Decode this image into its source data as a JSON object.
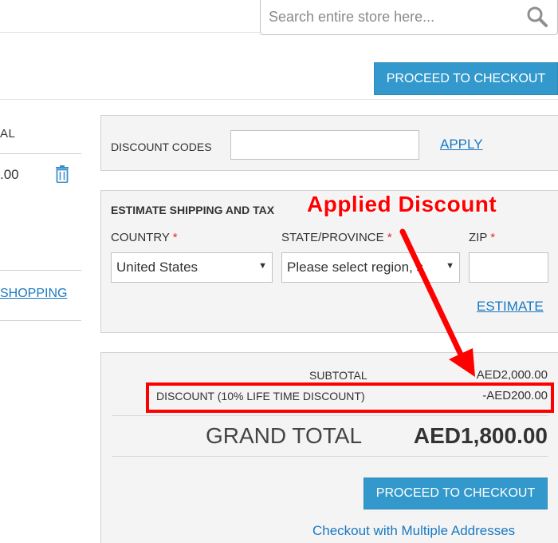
{
  "search": {
    "placeholder": "Search entire store here..."
  },
  "buttons": {
    "proceed_top": "PROCEED TO CHECKOUT",
    "proceed_bottom": "PROCEED TO CHECKOUT"
  },
  "cart": {
    "column_header_fragment": "AL",
    "item_subtotal_fragment": ".00",
    "continue_shopping_fragment": "SHOPPING"
  },
  "discount": {
    "label": "DISCOUNT CODES",
    "input_value": "",
    "apply_label": "APPLY"
  },
  "shipping": {
    "title": "ESTIMATE SHIPPING AND TAX",
    "country_label": "COUNTRY",
    "state_label": "STATE/PROVINCE",
    "zip_label": "ZIP",
    "required_marker": "*",
    "country_value": "United States",
    "state_value": "Please select region, s",
    "zip_value": "",
    "estimate_label": "ESTIMATE"
  },
  "totals": {
    "subtotal_label": "SUBTOTAL",
    "subtotal_value": "AED2,000.00",
    "discount_label": "DISCOUNT (10% LIFE TIME DISCOUNT)",
    "discount_value": "-AED200.00",
    "grand_total_label": "GRAND TOTAL",
    "grand_total_value": "AED1,800.00"
  },
  "multi_address_link": "Checkout with Multiple Addresses",
  "annotation": {
    "text": "Applied Discount",
    "color": "#ff0000"
  },
  "colors": {
    "accent": "#3399cc",
    "link": "#1979c3",
    "required": "#e02b27",
    "panel": "#f4f4f4"
  },
  "icons": [
    "search-icon",
    "trash-icon",
    "chevron-down-icon",
    "arrow-annotation"
  ]
}
